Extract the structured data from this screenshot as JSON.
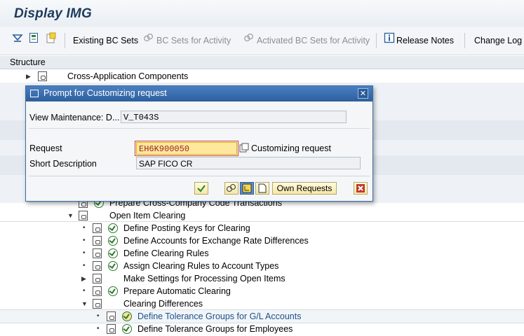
{
  "window": {
    "title": "Display IMG"
  },
  "toolbar": {
    "existing_bc_sets": "Existing BC Sets",
    "bc_sets_for_activity": "BC Sets for Activity",
    "activated_bc_sets_for_activity": "Activated BC Sets for Activity",
    "release_notes": "Release Notes",
    "change_log": "Change Log"
  },
  "structure": {
    "header": "Structure",
    "items": [
      {
        "label": "Cross-Application Components",
        "level": 1,
        "expanded": false
      },
      {
        "label": "Prepare Cross-Company Code Transactions",
        "level": 3,
        "executable": true
      },
      {
        "label": "Open Item Clearing",
        "level": 3,
        "expanded": true
      },
      {
        "label": "Define Posting Keys for Clearing",
        "level": 4,
        "executable": true
      },
      {
        "label": "Define Accounts for Exchange Rate Differences",
        "level": 4,
        "executable": true
      },
      {
        "label": "Define Clearing Rules",
        "level": 4,
        "executable": true
      },
      {
        "label": "Assign Clearing Rules to Account Types",
        "level": 4,
        "executable": true
      },
      {
        "label": "Make Settings for Processing Open Items",
        "level": 4,
        "expanded": false
      },
      {
        "label": "Prepare Automatic Clearing",
        "level": 4,
        "executable": true
      },
      {
        "label": "Clearing Differences",
        "level": 4,
        "expanded": true
      },
      {
        "label": "Define Tolerance Groups for G/L Accounts",
        "level": 5,
        "executable": true,
        "selected": true
      },
      {
        "label": "Define Tolerance Groups for Employees",
        "level": 5,
        "executable": true
      }
    ]
  },
  "dialog": {
    "title": "Prompt for Customizing request",
    "view_maintenance_label": "View Maintenance: D...",
    "view_maintenance_value": "V_T043S",
    "request_label": "Request",
    "request_value": "EH6K900050",
    "customizing_request_label": "Customizing request",
    "short_description_label": "Short Description",
    "short_description_value": "SAP FICO CR",
    "own_requests_button": "Own Requests"
  },
  "colors": {
    "title_text": "#1d3a5c",
    "dialog_title_bar": "#2d5f9e",
    "request_field_bg": "#fde89c",
    "exec_icon": "#2f7a2f",
    "cancel_button": "#c0392b"
  }
}
